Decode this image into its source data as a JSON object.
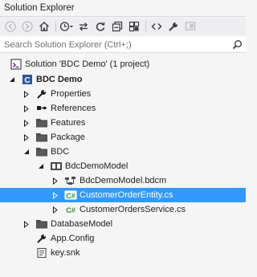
{
  "window": {
    "title": "Solution Explorer"
  },
  "toolbar": {
    "icons": [
      "back-icon",
      "forward-icon",
      "home-icon",
      "history-icon",
      "sync-icon",
      "refresh-icon",
      "collapse-all-icon",
      "show-all-files-icon",
      "view-code-icon",
      "properties-icon",
      "preview-icon"
    ]
  },
  "search": {
    "placeholder": "Search Solution Explorer (Ctrl+;)",
    "value": ""
  },
  "tree": {
    "solution": "Solution 'BDC Demo' (1 project)",
    "project": "BDC Demo",
    "properties": "Properties",
    "references": "References",
    "features": "Features",
    "package": "Package",
    "bdc": "BDC",
    "bdc_demo_model": "BdcDemoModel",
    "bdcm_file": "BdcDemoModel.bdcm",
    "customer_order_entity": "CustomerOrderEntity.cs",
    "customer_orders_service": "CustomerOrdersService.cs",
    "database_model": "DatabaseModel",
    "app_config": "App.Config",
    "key_snk": "key.snk"
  },
  "colors": {
    "selection": "#3399ff",
    "cs_icon": "#2f8f2f",
    "folder": "#4a4a4a",
    "project_icon": "#2b579a"
  }
}
